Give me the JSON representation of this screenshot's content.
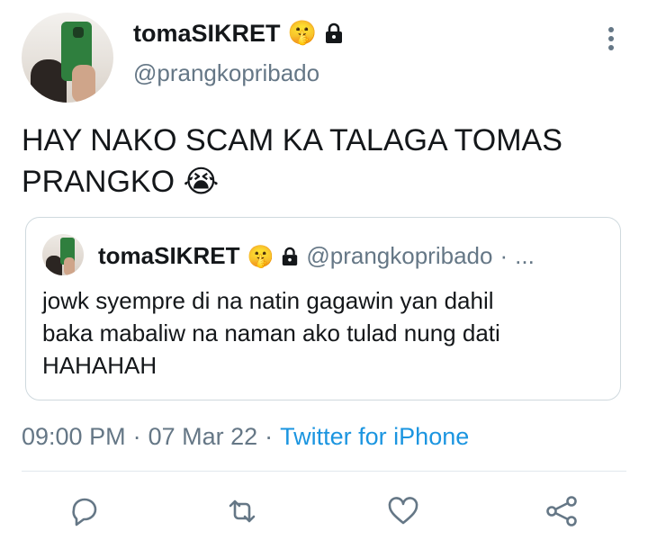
{
  "tweet": {
    "author": {
      "display_name": "tomaSIKRET",
      "name_emoji": "🤫",
      "handle": "@prangkopribado",
      "avatar_icon": "avatar-photo"
    },
    "text_line1": "HAY NAKO SCAM KA TALAGA TOMAS",
    "text_line2": "PRANGKO",
    "text_emoji": "😭",
    "quoted": {
      "display_name": "tomaSIKRET",
      "name_emoji": "🤫",
      "handle": "@prangkopribado",
      "separator": "·",
      "ellipsis": "...",
      "text_line1": "jowk syempre di na natin gagawin yan dahil",
      "text_line2": "baka mabaliw na naman ako tulad nung dati",
      "text_line3": "HAHAHAH"
    },
    "meta": {
      "time": "09:00 PM",
      "sep1": "·",
      "date": "07 Mar 22",
      "sep2": "·",
      "source": "Twitter for iPhone"
    },
    "actions": [
      "reply-icon",
      "retweet-icon",
      "like-icon",
      "share-icon"
    ]
  },
  "colors": {
    "text": "#14171a",
    "secondary": "#657786",
    "link": "#1b95e0",
    "border": "#cfd9de"
  }
}
